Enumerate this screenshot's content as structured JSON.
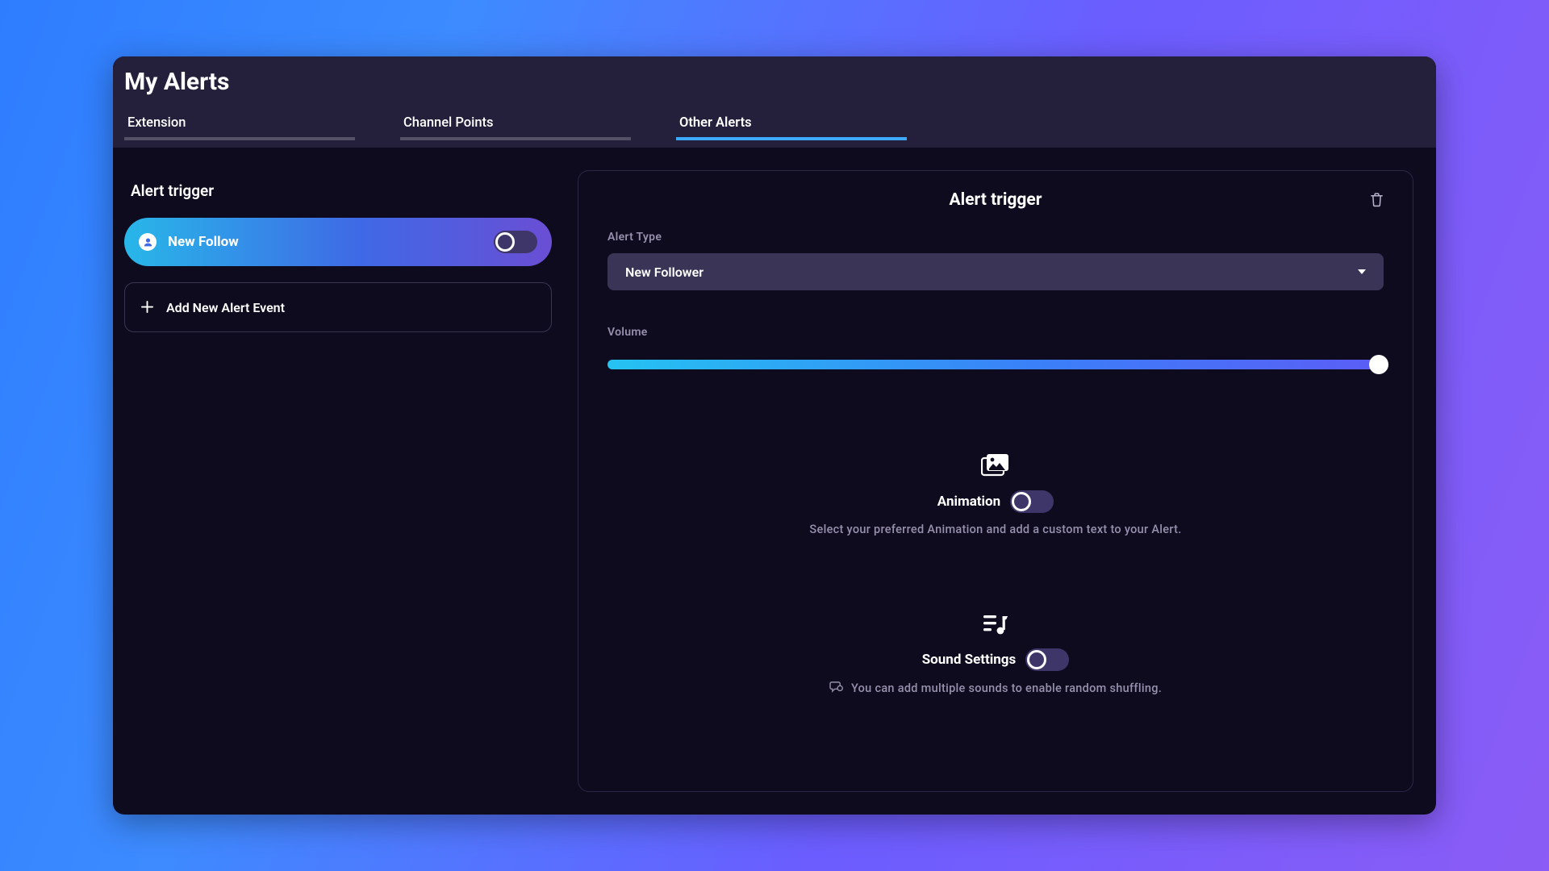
{
  "page_title": "My Alerts",
  "tabs": [
    {
      "label": "Extension",
      "active": false
    },
    {
      "label": "Channel Points",
      "active": false
    },
    {
      "label": "Other Alerts",
      "active": true
    }
  ],
  "sidebar": {
    "title": "Alert trigger",
    "items": [
      {
        "label": "New Follow",
        "enabled": false
      }
    ],
    "add_button_label": "Add New Alert Event"
  },
  "detail": {
    "title": "Alert trigger",
    "alert_type_label": "Alert Type",
    "alert_type_value": "New Follower",
    "volume_label": "Volume",
    "volume_value": 100,
    "animation": {
      "title": "Animation",
      "enabled": false,
      "description": "Select your preferred Animation and add a custom text to your Alert."
    },
    "sound": {
      "title": "Sound Settings",
      "enabled": false,
      "description": "You can add multiple sounds to enable random shuffling."
    }
  }
}
